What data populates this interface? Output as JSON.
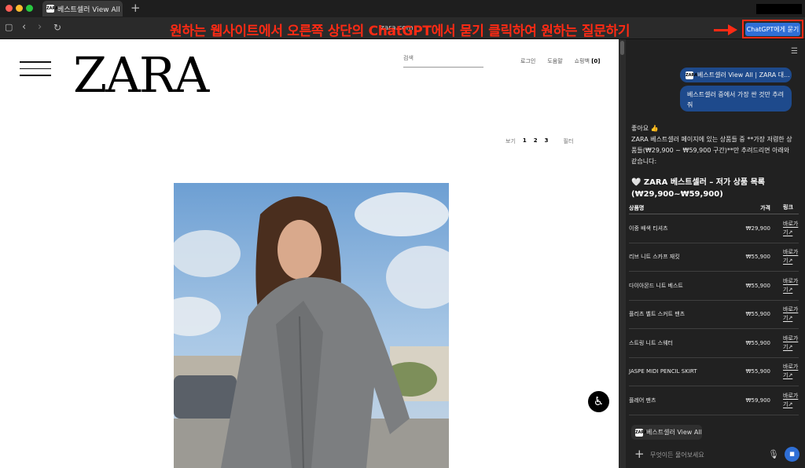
{
  "browser": {
    "tab_title": "베스트셀러 View All | Z",
    "favicon_text": "ZARA",
    "url": "zara.com"
  },
  "annotation": {
    "text": "원하는 웹사이트에서 오른쪽 상단의 ChatGPT에서 묻기 클릭하여 원하는 질문하기",
    "ask_button": "ChatGPT에게 묻기"
  },
  "site": {
    "logo": "ZARA",
    "search_placeholder": "검색",
    "nav": {
      "login": "로그인",
      "help": "도움말",
      "cart": "쇼핑백",
      "cart_count": "[0]"
    },
    "view": {
      "label": "보기",
      "opt1": "1",
      "opt2": "2",
      "opt3": "3",
      "filter": "필터"
    }
  },
  "chat": {
    "context_link": "베스트셀러 View All | ZARA 대...",
    "user_message": "베스트셀러 중에서 가장 싼 것만 추려줘",
    "reply_intro": "좋아요 👍",
    "reply_text": "ZARA 베스트셀러 페이지에 있는 상품들 중 **가장 저렴한 상품들(₩29,900 ~ ₩59,900 구간)**만 추려드리면 아래와 같습니다:",
    "section_title": "🤍 ZARA 베스트셀러 – 저가 상품 목록 (₩29,900~₩59,900)",
    "table": {
      "headers": [
        "상품명",
        "가격",
        "링크"
      ],
      "rows": [
        {
          "name": "이중 배색 티셔츠",
          "price": "₩29,900",
          "link": "바로가기↗"
        },
        {
          "name": "리브 니트 스카프 재킷",
          "price": "₩55,900",
          "link": "바로가기↗"
        },
        {
          "name": "다이아몬드 니트 베스트",
          "price": "₩55,900",
          "link": "바로가기↗"
        },
        {
          "name": "플리츠 벨트 스커트 팬츠",
          "price": "₩55,900",
          "link": "바로가기↗"
        },
        {
          "name": "스트링 니트 스웨터",
          "price": "₩55,900",
          "link": "바로가기↗"
        },
        {
          "name": "JASPE MIDI PENCIL SKIRT",
          "price": "₩55,900",
          "link": "바로가기↗"
        },
        {
          "name": "플레어 팬츠",
          "price": "₩59,900",
          "link": "바로가기↗"
        }
      ]
    },
    "chip_label": "베스트셀러 View All",
    "input_placeholder": "무엇이든 물어보세요"
  }
}
